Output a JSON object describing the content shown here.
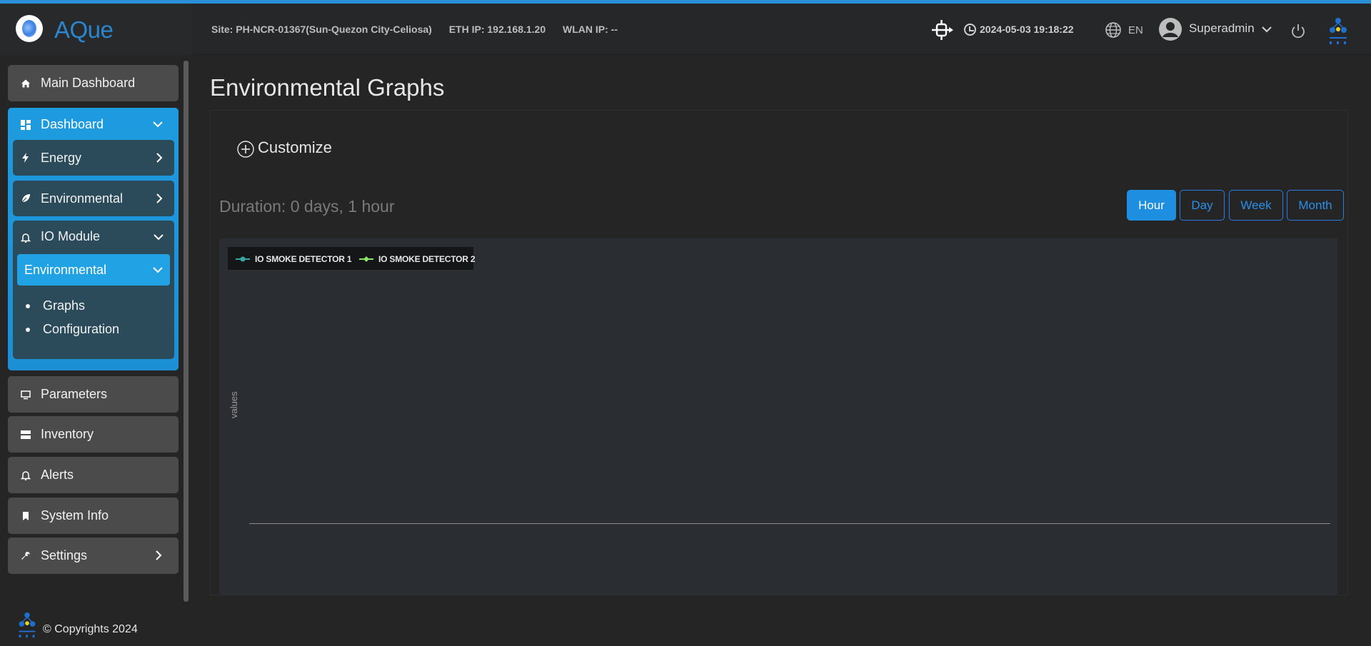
{
  "header": {
    "brand": "AQue",
    "site": "Site: PH-NCR-01367(Sun-Quezon City-Celiosa)",
    "eth_ip": "ETH IP: 192.168.1.20",
    "wlan_ip": "WLAN IP: --",
    "datetime": "2024-05-03 19:18:22",
    "language": "EN",
    "user": "Superadmin"
  },
  "sidebar": {
    "main_dashboard": "Main Dashboard",
    "dashboard": "Dashboard",
    "energy": "Energy",
    "environmental": "Environmental",
    "io_module": "IO Module",
    "io_environmental": "Environmental",
    "graphs": "Graphs",
    "configuration": "Configuration",
    "parameters": "Parameters",
    "inventory": "Inventory",
    "alerts": "Alerts",
    "system_info": "System Info",
    "settings": "Settings"
  },
  "footer": {
    "copyright": "© Copyrights 2024"
  },
  "main": {
    "title": "Environmental Graphs",
    "customize": "Customize",
    "duration": "Duration: 0 days, 1 hour",
    "ranges": [
      "Hour",
      "Day",
      "Week",
      "Month"
    ],
    "active_range": "Hour"
  },
  "chart_data": {
    "type": "line",
    "series": [
      {
        "name": "IO SMOKE DETECTOR 1",
        "color": "#3aa6a0",
        "values": []
      },
      {
        "name": "IO SMOKE DETECTOR 2",
        "color": "#8be36a",
        "values": []
      }
    ],
    "ylabel": "values",
    "xlabel": ""
  },
  "colors": {
    "accent": "#1e9be0",
    "background": "#252526"
  }
}
